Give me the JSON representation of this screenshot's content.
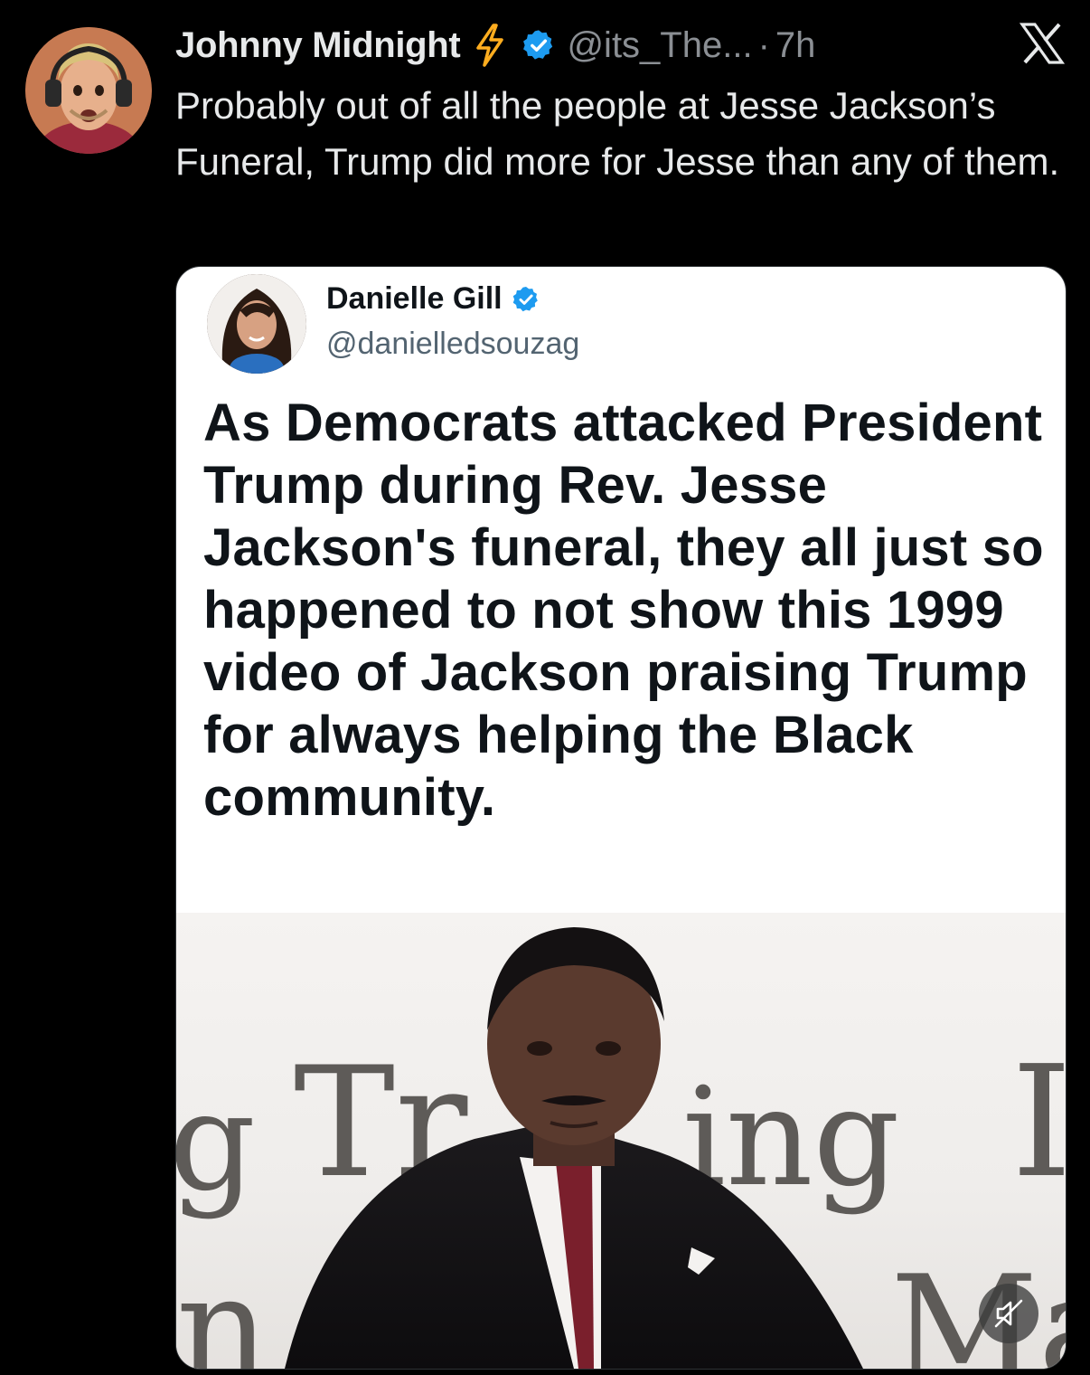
{
  "tweet": {
    "author_name": "Johnny Midnight",
    "handle": "@its_The...",
    "separator": "·",
    "time": "7h",
    "text": "Probably out of all the people at Jesse Jackson’s Funeral, Trump did more for Jesse than any of them.",
    "icons": [
      "lightning-bolt-icon",
      "verified-badge-icon",
      "x-logo-icon"
    ]
  },
  "quoted": {
    "author_name": "Danielle Gill",
    "handle": "@danielledsouzag",
    "text": "As Democrats attacked President Trump during Rev. Jesse Jackson's funeral, they all just so happened to not show this 1999 video of Jackson praising Trump for always helping the Black community.",
    "icons": [
      "verified-badge-icon"
    ]
  },
  "video": {
    "overlay_text": [
      "g",
      "Tr",
      "ing",
      "I",
      "n",
      "Ma"
    ],
    "controls": [
      "mute-icon"
    ]
  },
  "colors": {
    "background": "#000000",
    "verified": "#1d9bf0",
    "bolt": "#ffad1f",
    "muted_text": "#8b8f94"
  }
}
